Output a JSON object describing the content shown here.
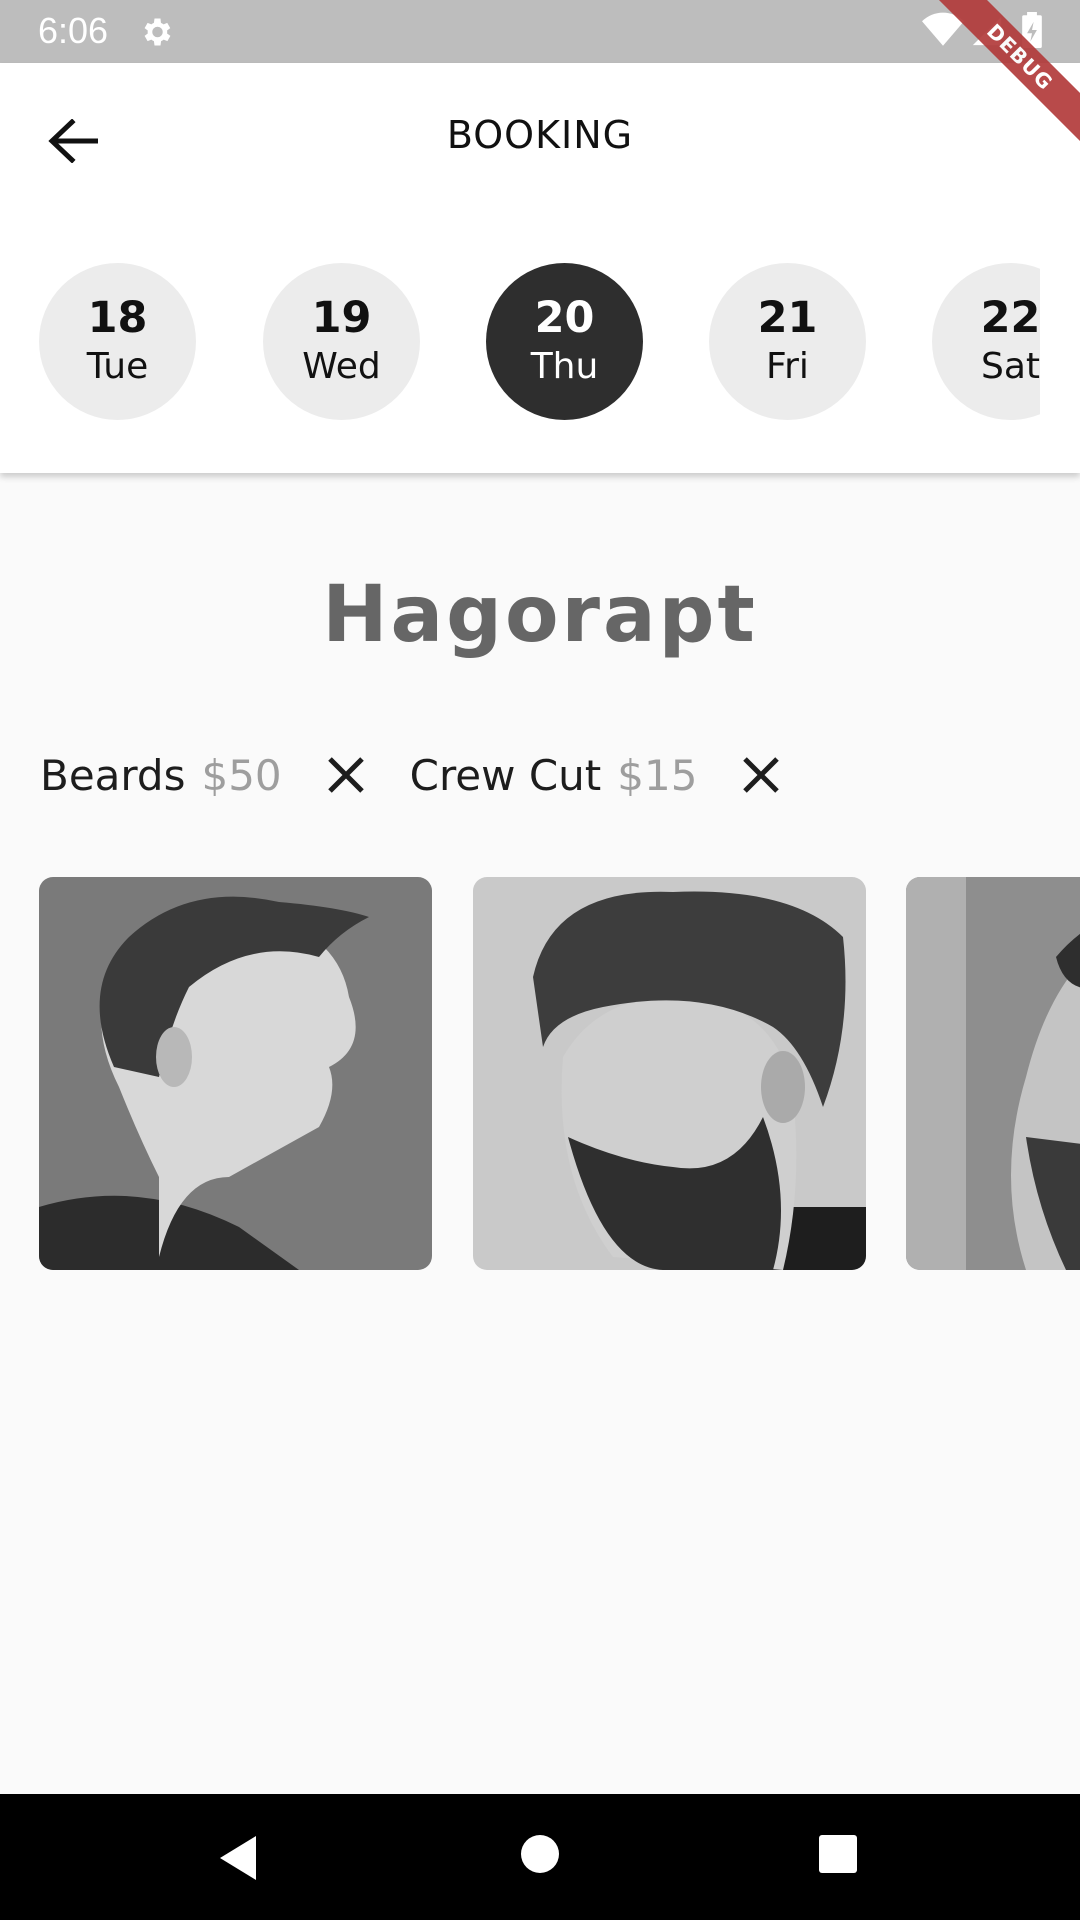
{
  "status_bar": {
    "time": "6:06",
    "icons": [
      "gear-icon",
      "wifi-icon",
      "signal-icon",
      "battery-icon"
    ]
  },
  "debug_banner": "DEBUG",
  "header": {
    "title": "BOOKING",
    "back_icon": "arrow-left-icon"
  },
  "dates": [
    {
      "day": "18",
      "weekday": "Tue",
      "selected": false
    },
    {
      "day": "19",
      "weekday": "Wed",
      "selected": false
    },
    {
      "day": "20",
      "weekday": "Thu",
      "selected": true
    },
    {
      "day": "21",
      "weekday": "Fri",
      "selected": false
    },
    {
      "day": "22",
      "weekday": "Sat",
      "selected": false
    }
  ],
  "shop": {
    "name": "Hagorapt"
  },
  "services": [
    {
      "name": "Beards",
      "price": "$50"
    },
    {
      "name": "Crew Cut",
      "price": "$15"
    }
  ],
  "gallery": {
    "photos": [
      "haircut-photo-side-fade",
      "haircut-photo-pompadour-beard",
      "haircut-photo-beard-profile"
    ]
  },
  "colors": {
    "selected_date": "#2e2e2e",
    "date_bg": "#ececec",
    "shop_name": "#666666",
    "price": "#9e9e9e"
  }
}
